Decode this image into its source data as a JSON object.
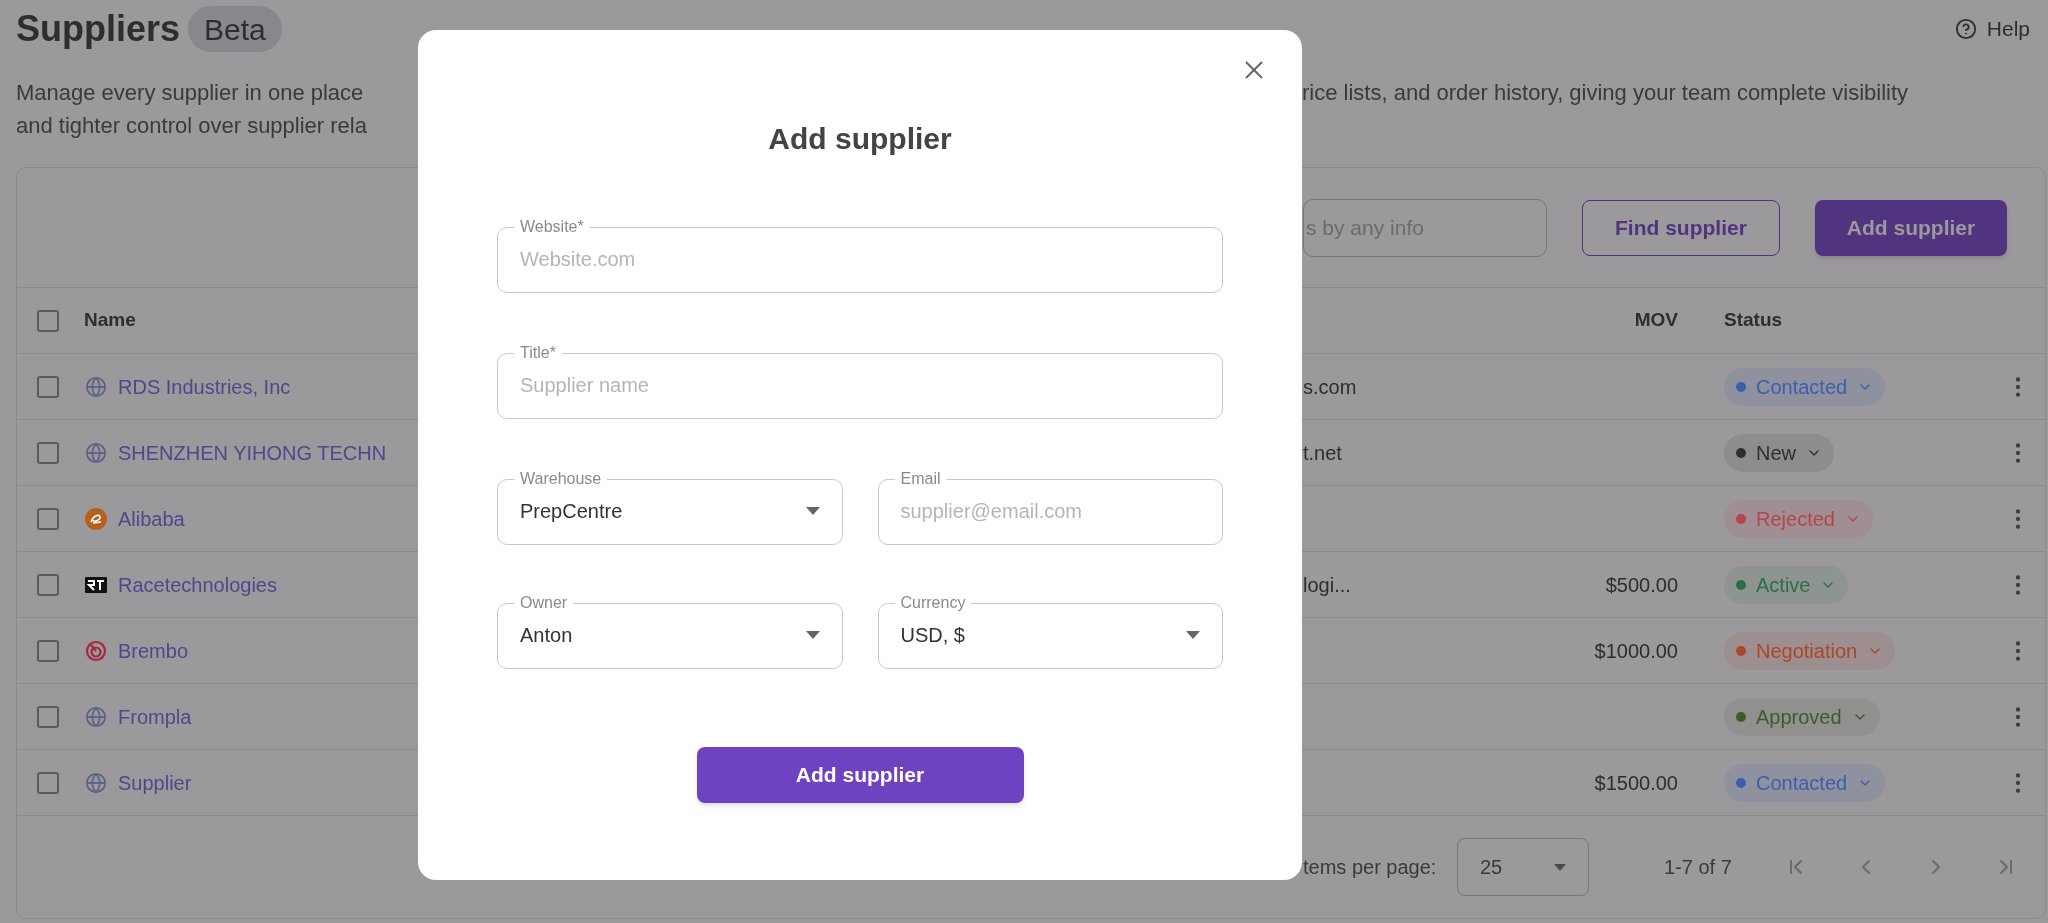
{
  "header": {
    "title": "Suppliers",
    "badge": "Beta",
    "help": "Help"
  },
  "description": {
    "left_lines": [
      "Manage every supplier in one place",
      "and tighter control over supplier rela"
    ],
    "right_fragment": "rice lists, and order history, giving your team complete visibility"
  },
  "toolbar": {
    "search": {
      "placeholder": "s by any info"
    },
    "buttons": [
      {
        "label": "Find supplier",
        "kind": "outline"
      },
      {
        "label": "Add supplier",
        "kind": "primary"
      }
    ]
  },
  "table": {
    "select_all": {
      "checked": false
    },
    "columns": [
      "Name",
      "MOV",
      "Status"
    ],
    "rows": [
      {
        "checked": false,
        "logo": {
          "kind": "globe"
        },
        "name": "RDS Industries, Inc",
        "column_3": "s.com",
        "status": {
          "label": "Contacted",
          "color": "#3b5fae"
        }
      },
      {
        "checked": false,
        "logo": {
          "kind": "globe"
        },
        "name": "SHENZHEN YIHONG TECHN",
        "column_3": "t.net",
        "status": {
          "label": "New",
          "color": "#2f2e31"
        }
      },
      {
        "checked": false,
        "logo": {
          "kind": "swoosh"
        },
        "name": "Alibaba",
        "status": {
          "label": "Rejected",
          "color": "#b9434b"
        }
      },
      {
        "checked": false,
        "logo": {
          "kind": "monogram"
        },
        "name": "Racetechnologies",
        "column_3": "logi...",
        "mov": "$500.00",
        "status": {
          "label": "Active",
          "color": "#2c6f45"
        }
      },
      {
        "checked": false,
        "logo": {
          "kind": "spiral"
        },
        "name": "Brembo",
        "mov": "$1000.00",
        "status": {
          "label": "Negotiation",
          "color": "#a9472c"
        }
      },
      {
        "checked": false,
        "logo": {
          "kind": "globe"
        },
        "name": "Frompla",
        "status": {
          "label": "Approved",
          "color": "#3e5a2b"
        }
      },
      {
        "checked": false,
        "logo": {
          "kind": "globe"
        },
        "name": "Supplier",
        "mov": "$1500.00",
        "status": {
          "label": "Contacted",
          "color": "#3b5fae"
        }
      }
    ]
  },
  "footer": {
    "per_page_label": "tems per page:",
    "per_page": "25",
    "range": "1-7 of 7"
  },
  "modal": {
    "title": "Add supplier",
    "fields": [
      {
        "kind": "text",
        "label": "Website*",
        "placeholder": "Website.com"
      },
      {
        "kind": "text",
        "label": "Title*",
        "placeholder": "Supplier name"
      },
      {
        "kind": "select",
        "label": "Warehouse",
        "value": "PrepCentre"
      },
      {
        "kind": "text",
        "label": "Email",
        "placeholder": "supplier@email.com"
      },
      {
        "kind": "select",
        "label": "Owner",
        "value": "Anton"
      },
      {
        "kind": "select",
        "label": "Currency",
        "value": "USD, $"
      }
    ],
    "submit": "Add supplier"
  }
}
